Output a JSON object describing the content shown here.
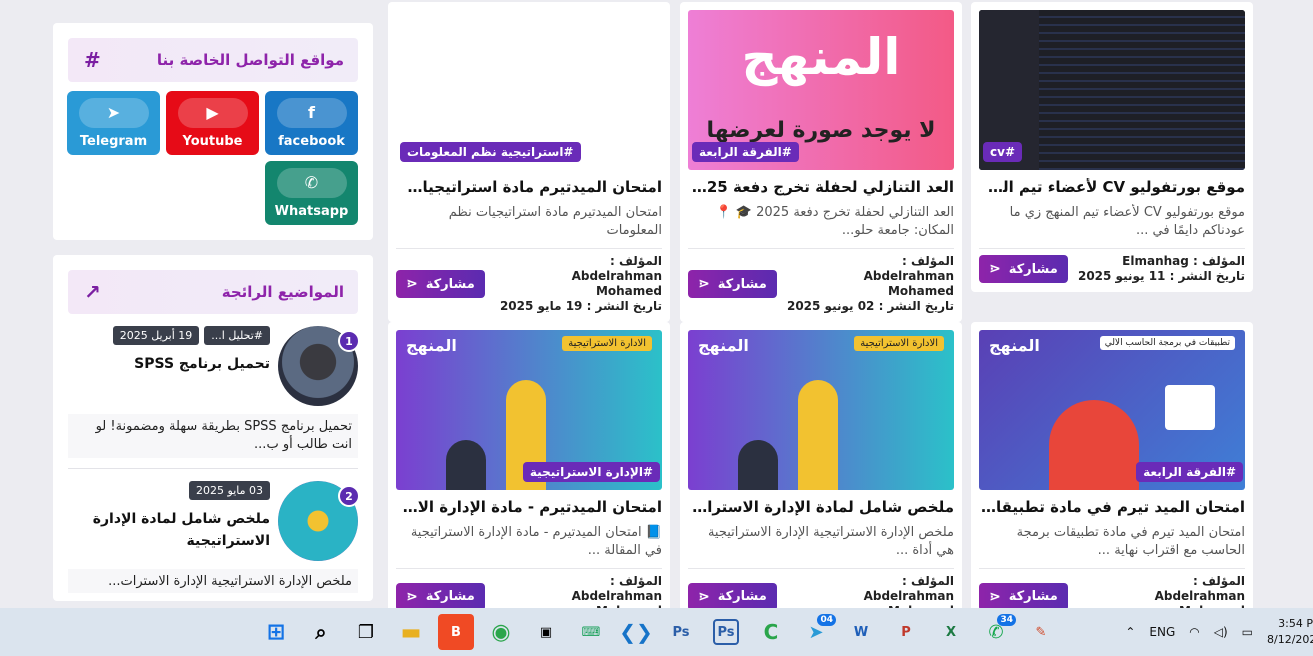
{
  "sidebar": {
    "social": {
      "title": "مواقع التواصل الخاصة بنا",
      "icon": "hash-icon",
      "buttons": [
        {
          "label": "facebook",
          "icon": "facebook-icon",
          "color": "#1877c5"
        },
        {
          "label": "Youtube",
          "icon": "youtube-icon",
          "color": "#e60b17"
        },
        {
          "label": "Telegram",
          "icon": "telegram-icon",
          "color": "#2a9ad6"
        },
        {
          "label": "Whatsapp",
          "icon": "whatsapp-icon",
          "color": "#13866e"
        }
      ]
    },
    "trending": {
      "title": "المواضيع الرائجة",
      "icon": "trending-icon",
      "items": [
        {
          "num": "1",
          "tag": "#تحليل ا...",
          "date": "19 أبريل 2025",
          "title": "تحميل برنامج SPSS",
          "excerpt": "تحميل برنامج SPSS بطريقة سهلة ومضمونة! لو انت طالب أو ب..."
        },
        {
          "num": "2",
          "tag": "",
          "date": "03 مايو 2025",
          "title": "ملخص شامل لمادة الإدارة الاستراتيجية",
          "excerpt": "ملخص الإدارة الاستراتيجية الإدارة الاسترات..."
        }
      ]
    }
  },
  "cards": [
    {
      "category": "#cv",
      "title": "موقع بورتفوليو CV لأعضاء تيم المنهج",
      "excerpt": "موقع بورتفوليو CV لأعضاء تيم المنهج زي ما عودناكم دايمًا في ...",
      "author": "المؤلف : Elmanhag",
      "date": "تاريخ النشر : 11 يونيو 2025",
      "share": "مشاركة"
    },
    {
      "category": "#الفرقة الرابعة",
      "title": "العد التنازلي لحفلة تخرج دفعة 2025",
      "excerpt": "العد التنازلي لحفلة تخرج دفعة 2025 🎓 📍 المكان: جامعة حلو...",
      "author": "المؤلف : Abdelrahman Mohamed",
      "date": "تاريخ النشر : 02 يونيو 2025",
      "share": "مشاركة",
      "image_text": "المنهج",
      "image_sub": "لا يوجد صورة لعرضها"
    },
    {
      "category": "#استراتيجية نظم المعلومات",
      "title": "امتحان الميدتيرم مادة استراتيجيات نظم المعلومات",
      "excerpt": "امتحان الميدتيرم مادة استراتيجيات نظم المعلومات",
      "author": "المؤلف : Abdelrahman Mohamed",
      "date": "تاريخ النشر : 19 مايو 2025",
      "share": "مشاركة"
    },
    {
      "category": "#الفرقة الرابعة",
      "title": "امتحان الميد تيرم في مادة تطبيقات برمجة الحاسب",
      "excerpt": "امتحان الميد تيرم في مادة تطبيقات برمجة الحاسب مع اقتراب نهاية ...",
      "author": "المؤلف : Abdelrahman Mohamed",
      "date": "",
      "share": "مشاركة",
      "image_text": "المنهج",
      "image_sub": "تطبيقات في برمجة الحاسب الالي"
    },
    {
      "category": "",
      "title": "ملخص شامل لمادة الإدارة الاستراتيجية",
      "excerpt": "ملخص الإدارة الاستراتيجية الإدارة الاستراتيجية هي أداة ...",
      "author": "المؤلف : Abdelrahman Mohamed",
      "date": "",
      "share": "مشاركة",
      "image_text": "المنهج",
      "image_sub": "الادارة الاستراتيجية"
    },
    {
      "category": "#الإدارة الاستراتيجية",
      "title": "امتحان الميدتيرم - مادة الإدارة الاستراتيجية",
      "excerpt": "📘 امتحان الميدتيرم - مادة الإدارة الاستراتيجية في المقالة ...",
      "author": "المؤلف : Abdelrahman Mohamed",
      "date": "",
      "share": "مشاركة",
      "image_text": "المنهج",
      "image_sub": "الادارة الاستراتيجية"
    }
  ],
  "taskbar": {
    "telegram_count": "04",
    "whatsapp_count": "34",
    "lang": "ENG",
    "time": "3:54 P",
    "date": "8/12/202"
  }
}
